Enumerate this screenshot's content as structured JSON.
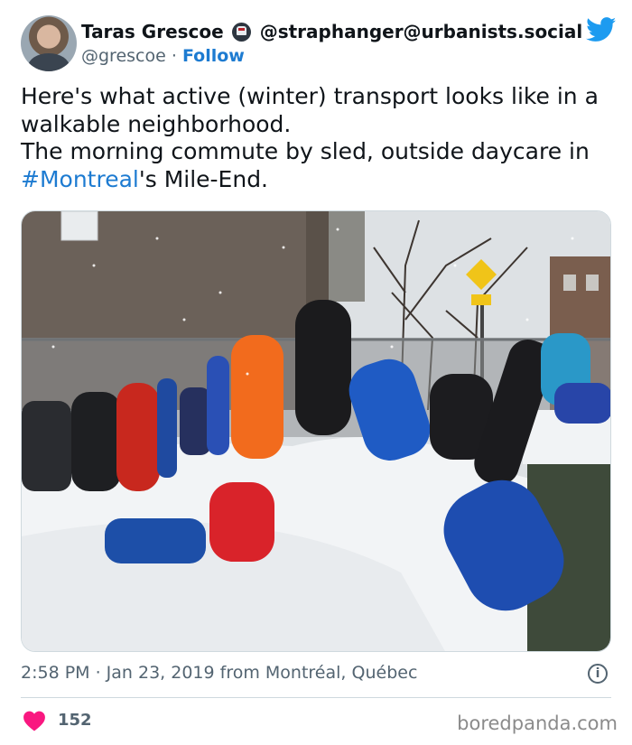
{
  "author": {
    "name": "Taras Grescoe",
    "mastodon_handle": "@straphanger@urbanists.social",
    "handle": "@grescoe",
    "separator": "·",
    "follow_label": "Follow"
  },
  "tweet": {
    "line1": "Here's what active (winter) transport looks like in a",
    "line2": "walkable neighborhood.",
    "line3": "The morning commute by sled, outside daycare in",
    "hashtag": "#Montreal",
    "line4_rest": "'s Mile-End."
  },
  "meta": {
    "timestamp": "2:58 PM · Jan 23, 2019 from Montréal, Québec",
    "info_symbol": "i"
  },
  "stats": {
    "likes": "152"
  },
  "watermark": "boredpanda.com",
  "colors": {
    "accent": "#1d9bf0",
    "link": "#1d7bd1",
    "heart": "#f91880",
    "text": "#0f1419",
    "muted": "#536471"
  },
  "icons": [
    "train-icon",
    "twitter-bird-icon",
    "info-icon",
    "heart-icon"
  ]
}
